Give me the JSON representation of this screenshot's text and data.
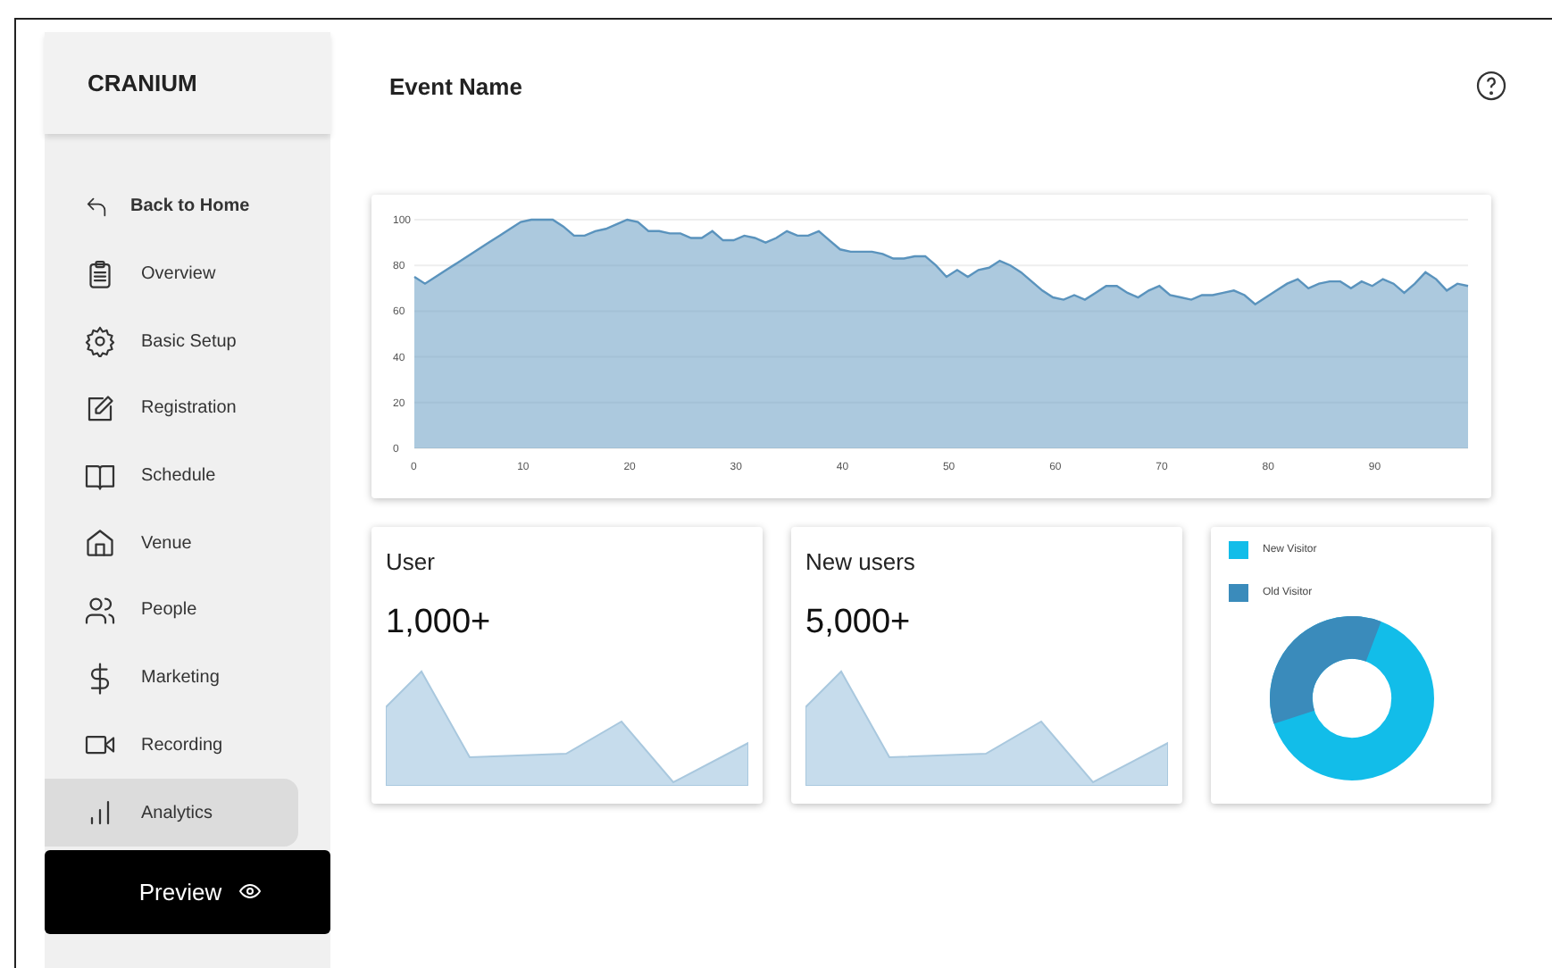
{
  "sidebar": {
    "brand": "CRANIUM",
    "back": {
      "label": "Back to Home"
    },
    "items": [
      {
        "kind": "overview",
        "label": "Overview",
        "selected": false
      },
      {
        "kind": "setup",
        "label": "Basic Setup",
        "selected": false
      },
      {
        "kind": "registration",
        "label": "Registration",
        "selected": false
      },
      {
        "kind": "schedule",
        "label": "Schedule",
        "selected": false
      },
      {
        "kind": "venue",
        "label": "Venue",
        "selected": false
      },
      {
        "kind": "people",
        "label": "People",
        "selected": false
      },
      {
        "kind": "marketing",
        "label": "Marketing",
        "selected": false
      },
      {
        "kind": "recording",
        "label": "Recording",
        "selected": false
      },
      {
        "kind": "analytics",
        "label": "Analytics",
        "selected": true
      }
    ],
    "preview_button": {
      "label": "Preview"
    }
  },
  "header": {
    "title": "Event Name"
  },
  "main_chart": {
    "chart_data": {
      "type": "area",
      "x": [
        0,
        1,
        2,
        3,
        4,
        5,
        6,
        7,
        8,
        9,
        10,
        11,
        12,
        13,
        14,
        15,
        16,
        17,
        18,
        19,
        20,
        21,
        22,
        23,
        24,
        25,
        26,
        27,
        28,
        29,
        30,
        31,
        32,
        33,
        34,
        35,
        36,
        37,
        38,
        39,
        40,
        41,
        42,
        43,
        44,
        45,
        46,
        47,
        48,
        49,
        50,
        51,
        52,
        53,
        54,
        55,
        56,
        57,
        58,
        59,
        60,
        61,
        62,
        63,
        64,
        65,
        66,
        67,
        68,
        69,
        70,
        71,
        72,
        73,
        74,
        75,
        76,
        77,
        78,
        79,
        80,
        81,
        82,
        83,
        84,
        85,
        86,
        87,
        88,
        89,
        90,
        91,
        92,
        93,
        94,
        95,
        96,
        97,
        98,
        99
      ],
      "series": [
        {
          "color": "#5a93bd",
          "values": [
            75,
            72,
            75,
            78,
            81,
            84,
            87,
            90,
            93,
            96,
            99,
            100,
            100,
            100,
            97,
            93,
            93,
            95,
            96,
            98,
            100,
            99,
            95,
            95,
            94,
            94,
            92,
            92,
            95,
            91,
            91,
            93,
            92,
            90,
            92,
            95,
            93,
            93,
            95,
            91,
            87,
            86,
            86,
            86,
            85,
            83,
            83,
            84,
            84,
            80,
            75,
            78,
            75,
            78,
            79,
            82,
            80,
            77,
            73,
            69,
            66,
            65,
            67,
            65,
            68,
            71,
            71,
            68,
            66,
            69,
            71,
            67,
            66,
            65,
            67,
            67,
            68,
            69,
            67,
            63,
            66,
            69,
            72,
            74,
            70,
            72,
            73,
            73,
            70,
            73,
            71,
            74,
            72,
            68,
            72,
            77,
            74,
            69,
            72,
            71
          ]
        }
      ],
      "xlim": [
        0,
        99
      ],
      "ylim": [
        0,
        100
      ],
      "xticks": [
        0,
        10,
        20,
        30,
        40,
        50,
        60,
        70,
        80,
        90
      ],
      "yticks": [
        0,
        20,
        40,
        60,
        80,
        100
      ],
      "grid": true
    }
  },
  "stat_cards": [
    {
      "title": "User",
      "value": "1,000+"
    },
    {
      "title": "New users",
      "value": "5,000+"
    }
  ],
  "visitors": {
    "legend": [
      {
        "label": "New Visitor",
        "color": "#12bde9"
      },
      {
        "label": "Old Visitor",
        "color": "#3a8bbb"
      }
    ]
  }
}
